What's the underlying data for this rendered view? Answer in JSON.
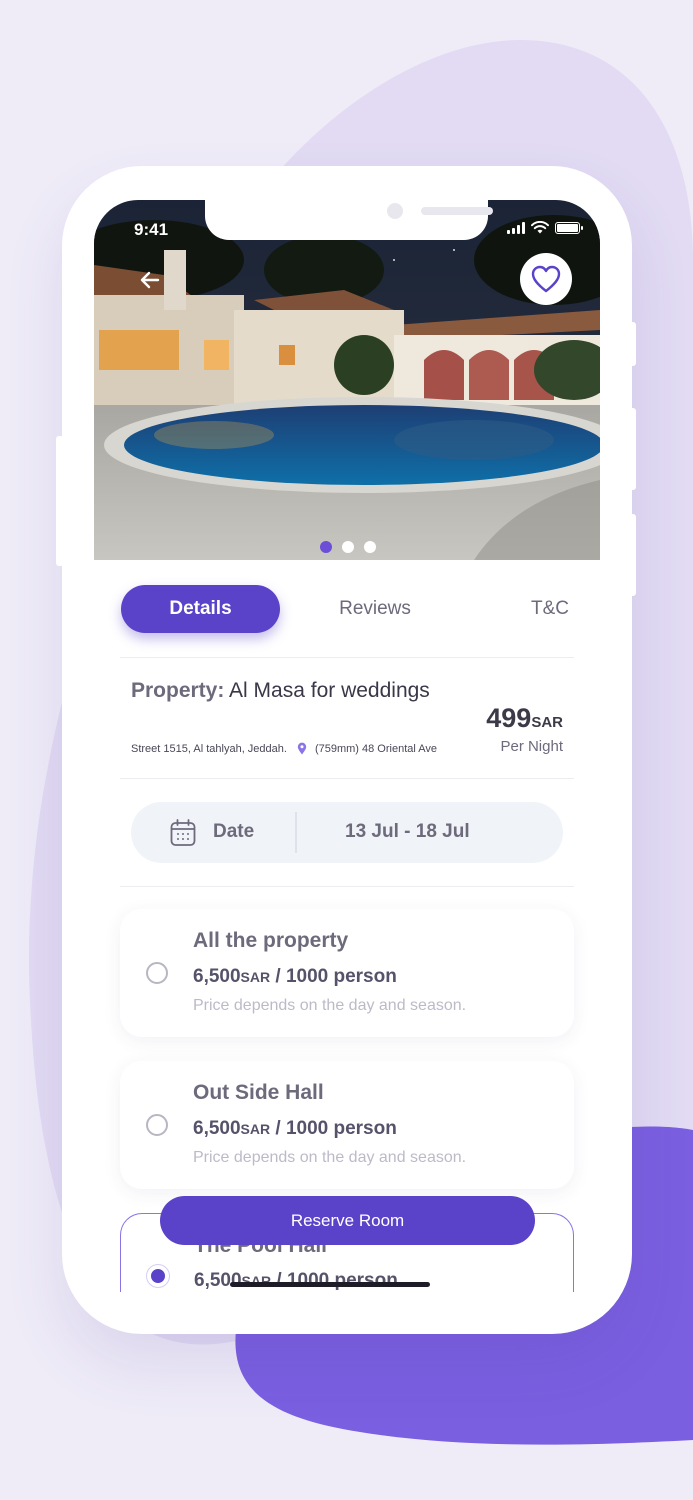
{
  "status_bar": {
    "time": "9:41"
  },
  "hero": {
    "slides": 3,
    "active_slide": 1
  },
  "tabs": [
    {
      "label": "Details",
      "active": true
    },
    {
      "label": "Reviews",
      "active": false
    },
    {
      "label": "T&C",
      "active": false
    }
  ],
  "property": {
    "label": "Property:",
    "name": "Al Masa for weddings",
    "address": "Street 1515, Al tahlyah, Jeddah.",
    "location": "(759mm) 48 Oriental Ave",
    "price": "499",
    "currency": "SAR",
    "price_unit": "Per Night"
  },
  "date": {
    "label": "Date",
    "range": "13 Jul - 18 Jul"
  },
  "options": [
    {
      "title": "All the property",
      "price": "6,500",
      "currency": "SAR",
      "capacity": "/ 1000 person",
      "note": "Price depends on the day and season.",
      "selected": false
    },
    {
      "title": "Out Side Hall",
      "price": "6,500",
      "currency": "SAR",
      "capacity": "/ 1000 person",
      "note": "Price depends on the day and season.",
      "selected": false
    },
    {
      "title": "The Pool Hall",
      "price": "6,500",
      "currency": "SAR",
      "capacity": "/ 1000 person",
      "note": "",
      "selected": true
    }
  ],
  "reserve_button": {
    "label": "Reserve Room"
  },
  "colors": {
    "accent": "#5a43c9",
    "background": "#efecf8",
    "text": "#3a3748",
    "muted": "#6d6a7c"
  },
  "icons": [
    "back-arrow-icon",
    "heart-icon",
    "map-pin-icon",
    "calendar-icon",
    "signal-icon",
    "wifi-icon",
    "battery-icon"
  ]
}
